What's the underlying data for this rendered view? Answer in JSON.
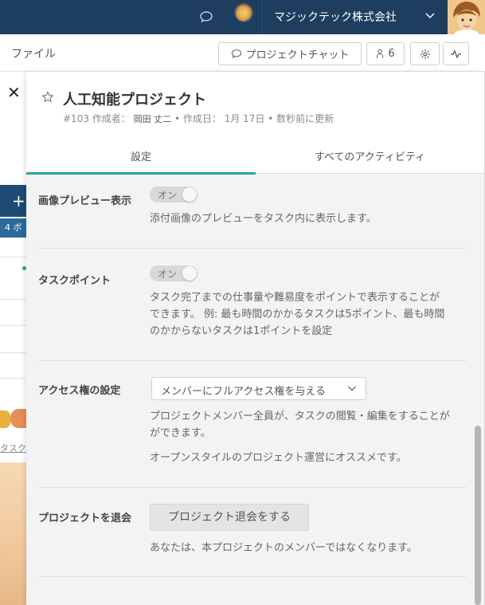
{
  "topbar": {
    "company_name": "マジックテック株式会社",
    "icons": [
      "chat-icon",
      "help-icon",
      "chevron-down-icon",
      "avatar"
    ],
    "colors": {
      "background": "#1d3e5f",
      "accent": "#2ba4a0"
    }
  },
  "subheader": {
    "file_menu": "ファイル",
    "chat_button": "プロジェクトチャット",
    "member_count": "6"
  },
  "background": {
    "board_label": "4 ボ",
    "task_link": "タスクを"
  },
  "project": {
    "title": "人工知能プロジェクト",
    "number": "#103",
    "author_prefix": "作成者：",
    "author": "岡田 丈二",
    "created_prefix": "• 作成日：",
    "created_date": "1月 17日",
    "updated": "• 数秒前に更新"
  },
  "tabs": [
    {
      "label": "設定",
      "active": true
    },
    {
      "label": "すべてのアクティビティ",
      "active": false
    }
  ],
  "settings": {
    "image_preview": {
      "label": "画像プレビュー表示",
      "toggle": "オン",
      "desc": "添付画像のプレビューをタスク内に表示します。"
    },
    "task_points": {
      "label": "タスクポイント",
      "toggle": "オン",
      "desc_lines": [
        "タスク完了までの仕事量や難易度をポイントで表示することが",
        "できます。 例: 最も時間のかかるタスクは5ポイント、最も時間",
        "のかからないタスクは1ポイントを設定"
      ]
    },
    "access": {
      "label": "アクセス権の設定",
      "selected": "メンバーにフルアクセス権を与える",
      "desc_lines": [
        "プロジェクトメンバー全員が、タスクの閲覧・編集をすることが",
        "ができます。"
      ],
      "note": "オープンスタイルのプロジェクト運営にオススメです。"
    },
    "leave": {
      "label": "プロジェクトを退会",
      "button": "プロジェクト退会をする",
      "desc": "あなたは、本プロジェクトのメンバーではなくなります。"
    }
  }
}
